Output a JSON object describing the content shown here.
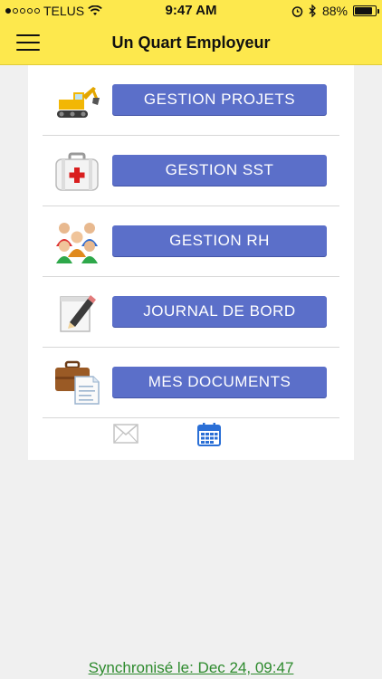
{
  "status_bar": {
    "carrier": "TELUS",
    "time": "9:47 AM",
    "battery": "88%",
    "battery_level": 0.88
  },
  "header": {
    "title": "Un Quart Employeur",
    "menu_icon": "hamburger-menu-icon"
  },
  "menu": {
    "items": [
      {
        "label": "GESTION PROJETS",
        "icon": "excavator-icon"
      },
      {
        "label": "GESTION SST",
        "icon": "first-aid-kit-icon"
      },
      {
        "label": "GESTION RH",
        "icon": "people-group-icon"
      },
      {
        "label": "JOURNAL DE BORD",
        "icon": "notepad-pencil-icon"
      },
      {
        "label": "MES DOCUMENTS",
        "icon": "briefcase-document-icon"
      }
    ]
  },
  "bottom_icons": [
    "mail-icon",
    "calendar-icon"
  ],
  "footer": {
    "sync_text": "Synchronisé le: Dec 24, 09:47"
  },
  "colors": {
    "header": "#fde84d",
    "button": "#5b6fc9",
    "sync_text": "#2d8a2d",
    "calendar_icon": "#2a6fd6"
  }
}
